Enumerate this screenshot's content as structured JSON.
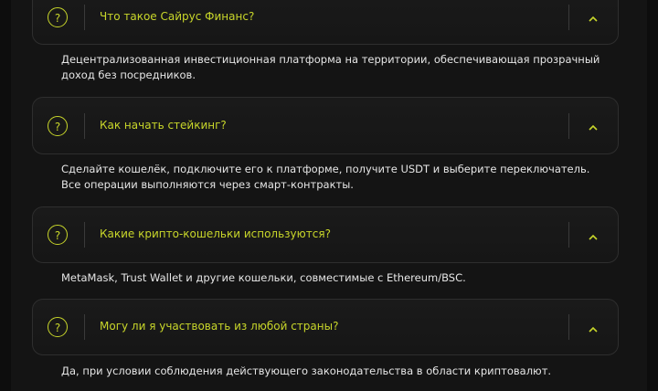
{
  "faq": [
    {
      "question": "Что такое Сайрус Финанс?",
      "answer": "Децентрализованная инвестиционная платформа на территории, обеспечивающая прозрачный доход без посредников."
    },
    {
      "question": "Как начать стейкинг?",
      "answer": "Сделайте кошелёк, подключите его к платформе, получите USDT и выберите переключатель. Все операции выполняются через смарт-контракты."
    },
    {
      "question": "Какие крипто-кошельки используются?",
      "answer": "MetaMask, Trust Wallet и другие кошельки, совместимые с Ethereum/BSC."
    },
    {
      "question": "Могу ли я участвовать из любой страны?",
      "answer": "Да, при условии соблюдения действующего законодательства в области криптовалют."
    }
  ],
  "badge_symbol": "?",
  "icons": {
    "badge": "question-mark-icon",
    "toggle": "chevron-up-icon"
  },
  "colors": {
    "accent": "#c8d62a",
    "answer_text": "#e6e6e6",
    "background": "#0d0d0d"
  }
}
